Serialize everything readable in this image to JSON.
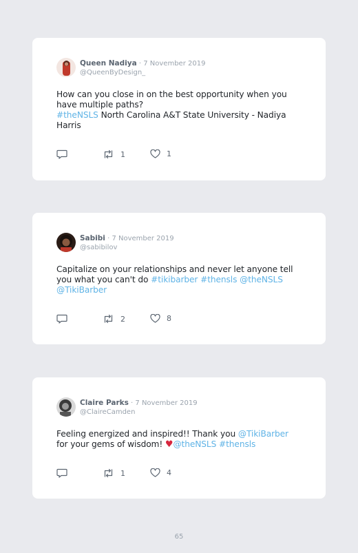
{
  "posts": [
    {
      "name": "Queen Nadiya",
      "separator": " · ",
      "date": "7 November 2019",
      "handle": "@QueenByDesign_",
      "avatar_color": "#c0392b",
      "text_parts": [
        {
          "text": "How can you close in on the best opportunity when you have multiple paths?",
          "link": false
        },
        {
          "text": "#theNSLS",
          "link": true
        },
        {
          "text": " North Carolina A&T State University - Nadiya Harris",
          "link": false
        }
      ],
      "retweets": "1",
      "likes": "1"
    },
    {
      "name": "Sabibi",
      "separator": " · ",
      "date": "7 November 2019",
      "handle": "@sabibilov",
      "avatar_color": "#3b2a22",
      "text_parts": [
        {
          "text": "Capitalize on your relationships and never let anyone tell you what you can't do ",
          "link": false
        },
        {
          "text": "#tikibarber",
          "link": true
        },
        {
          "text": " ",
          "link": false
        },
        {
          "text": "#thensls",
          "link": true
        },
        {
          "text": " ",
          "link": false
        },
        {
          "text": "@theNSLS",
          "link": true
        },
        {
          "text": " ",
          "link": false
        },
        {
          "text": "@TikiBarber",
          "link": true
        }
      ],
      "retweets": "2",
      "likes": "8"
    },
    {
      "name": "Claire Parks",
      "separator": " · ",
      "date": "7 November 2019",
      "handle": "@ClaireCamden",
      "avatar_color": "#6b6b6b",
      "text_parts": [
        {
          "text": "Feeling energized and inspired!! Thank you ",
          "link": false
        },
        {
          "text": "@TikiBarber",
          "link": true
        },
        {
          "text": " for your gems of wisdom! ",
          "link": false
        },
        {
          "text": "♥",
          "link": false,
          "emoji": true
        },
        {
          "text": "@theNSLS",
          "link": true
        },
        {
          "text": " ",
          "link": false
        },
        {
          "text": "#thensls",
          "link": true
        }
      ],
      "retweets": "1",
      "likes": "4"
    }
  ],
  "page_number": "65",
  "colors": {
    "background": "#e9eaee",
    "card": "#ffffff",
    "link": "#5fb3e6",
    "muted": "#9aa3ad",
    "name": "#5a6470"
  },
  "icons": {
    "reply": "reply-icon",
    "retweet": "retweet-icon",
    "like": "heart-icon"
  }
}
